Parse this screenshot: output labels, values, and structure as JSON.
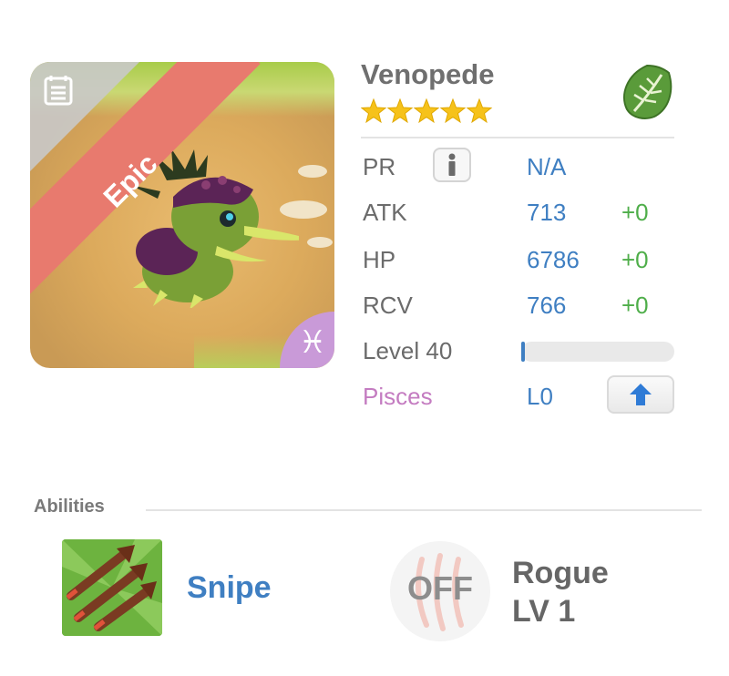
{
  "card": {
    "rarity": "Epic",
    "zodiac_glyph": "♓",
    "rarity_color": "#e87a6e",
    "zodiac_color": "#c99ad8"
  },
  "monster": {
    "name": "Venopede",
    "star_count": 5,
    "element_icon": "leaf-icon",
    "element_color": "#5a9b3a"
  },
  "stats": {
    "pr": {
      "label": "PR",
      "value": "N/A",
      "info_icon": "info-icon"
    },
    "atk": {
      "label": "ATK",
      "value": "713",
      "bonus": "+0"
    },
    "hp": {
      "label": "HP",
      "value": "6786",
      "bonus": "+0"
    },
    "rcv": {
      "label": "RCV",
      "value": "766",
      "bonus": "+0"
    },
    "level": {
      "label": "Level 40",
      "progress": 0.01
    },
    "sign": {
      "label": "Pisces",
      "value": "L0",
      "upgrade_icon": "arrow-up-icon"
    }
  },
  "abilities": {
    "heading": "Abilities",
    "skill": {
      "name": "Snipe",
      "icon": "arrows-icon"
    },
    "passive": {
      "status": "OFF",
      "name": "Rogue",
      "level": "LV 1",
      "icon": "claw-icon"
    }
  },
  "colors": {
    "value_blue": "#3f7fc2",
    "bonus_green": "#4fae4a",
    "pisces_purple": "#c47cc1",
    "star_gold": "#f6c21a"
  }
}
